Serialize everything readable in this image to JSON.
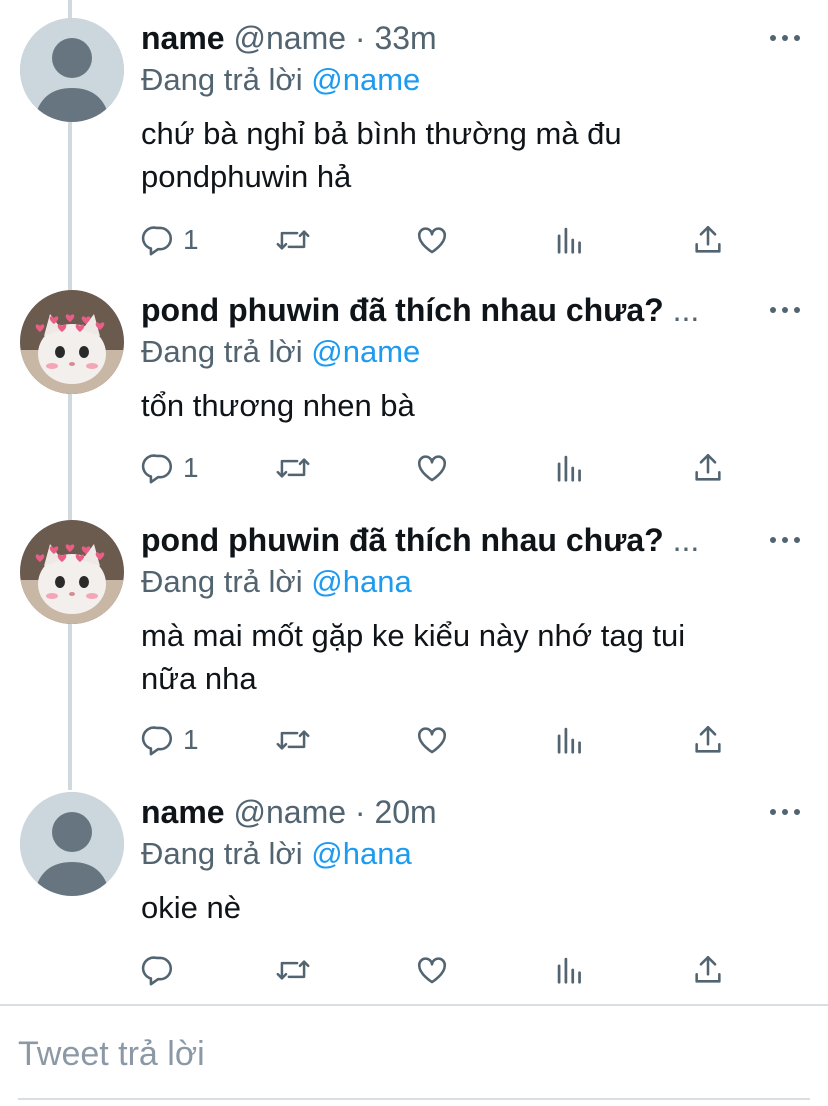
{
  "tweets": [
    {
      "name": "name",
      "handle": "@name",
      "time": "33m",
      "replying_prefix": "Đang trả lời",
      "replying_to": "@name",
      "text_lines": [
        "chứ bà nghỉ bả bình thường mà đu",
        "pondphuwin hả"
      ],
      "reply_count": "1",
      "avatar": "default-avatar"
    },
    {
      "name": "pond phuwin đã thích nhau chưa?",
      "ellipsis": "...",
      "replying_prefix": "Đang trả lời",
      "replying_to": "@name",
      "text_lines": [
        "tổn thương nhen bà"
      ],
      "reply_count": "1",
      "avatar": "cat-with-hearts-avatar"
    },
    {
      "name": "pond phuwin đã thích nhau chưa?",
      "ellipsis": "...",
      "replying_prefix": "Đang trả lời",
      "replying_to": "@hana",
      "text_lines": [
        "mà mai mốt gặp ke kiểu này nhớ tag tui",
        "nữa nha"
      ],
      "reply_count": "1",
      "avatar": "cat-with-hearts-avatar"
    },
    {
      "name": "name",
      "handle": "@name",
      "time": "20m",
      "replying_prefix": "Đang trả lời",
      "replying_to": "@hana",
      "text_lines": [
        "okie nè"
      ],
      "reply_count": "",
      "avatar": "default-avatar"
    }
  ],
  "separator": "·",
  "reply_box": {
    "placeholder": "Tweet trả lời"
  },
  "colors": {
    "link": "#1d9bf0",
    "secondary": "#536471",
    "thread_line": "#cfd9de"
  },
  "icons": [
    "reply-icon",
    "retweet-icon",
    "like-icon",
    "analytics-icon",
    "share-icon",
    "more-icon"
  ]
}
